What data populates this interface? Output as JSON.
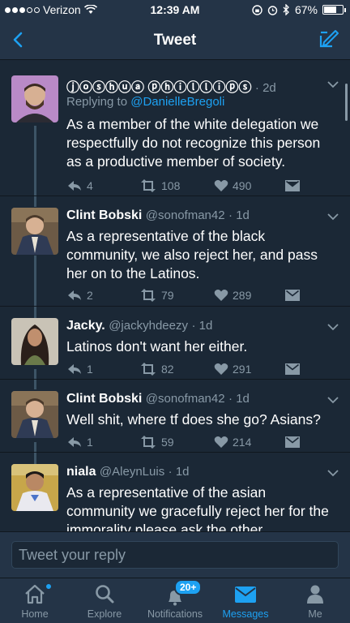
{
  "status_bar": {
    "carrier": "Verizon",
    "time": "12:39 AM",
    "battery": "67%",
    "battery_level": 0.67,
    "signal_bars_filled": 3,
    "signal_bars_total": 5
  },
  "nav": {
    "title": "Tweet",
    "back_icon": "chevron-left-icon",
    "compose_icon": "compose-tweet-icon"
  },
  "colors": {
    "accent": "#1da1f2",
    "background": "#1b2836",
    "bar": "#243447",
    "secondary_text": "#8899a6"
  },
  "tweets": [
    {
      "name": "ⓙⓞⓢⓗⓤⓐ ⓟⓗⓘⓛⓛⓘⓟⓢ",
      "handle": "",
      "time": "· 2d",
      "reply_prefix": "Replying to ",
      "reply_to": "@DanielleBregoli",
      "text": "As a member of the white delegation we respectfully do not recognize this person as a productive member of society.",
      "replies": "4",
      "retweets": "108",
      "likes": "490"
    },
    {
      "name": "Clint Bobski",
      "handle": "@sonofman42",
      "time": "· 1d",
      "text": "As a representative of the black community, we also reject her, and pass her on to the Latinos.",
      "replies": "2",
      "retweets": "79",
      "likes": "289"
    },
    {
      "name": "Jacky.",
      "handle": "@jackyhdeezy",
      "time": "· 1d",
      "text": "Latinos don't want her either.",
      "replies": "1",
      "retweets": "82",
      "likes": "291"
    },
    {
      "name": "Clint Bobski",
      "handle": "@sonofman42",
      "time": "· 1d",
      "text": "Well shit, where tf does she go? Asians?",
      "replies": "1",
      "retweets": "59",
      "likes": "214"
    },
    {
      "name": "niala",
      "handle": "@AleynLuis",
      "time": "· 1d",
      "text": "As a representative of the asian community we gracefully reject her for the immorality please ask the other",
      "replies": "",
      "retweets": "",
      "likes": ""
    }
  ],
  "reply_bar": {
    "placeholder": "Tweet your reply"
  },
  "tabs": [
    {
      "label": "Home",
      "icon": "home-icon",
      "active": false
    },
    {
      "label": "Explore",
      "icon": "search-icon",
      "active": false
    },
    {
      "label": "Notifications",
      "icon": "bell-icon",
      "active": false,
      "badge": "20+"
    },
    {
      "label": "Messages",
      "icon": "envelope-icon",
      "active": true
    },
    {
      "label": "Me",
      "icon": "person-icon",
      "active": false
    }
  ]
}
